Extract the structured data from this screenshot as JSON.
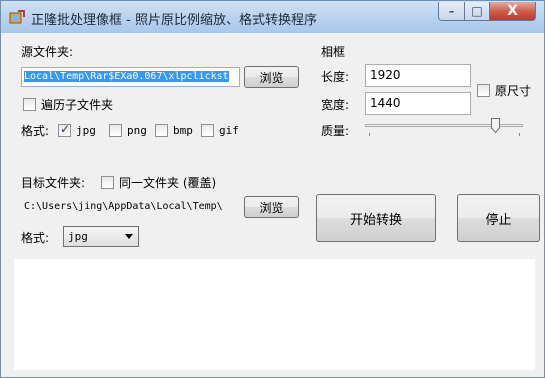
{
  "window": {
    "title": "正隆批处理像框 - 照片原比例缩放、格式转换程序",
    "minimize_label": "–",
    "maximize_label": "□",
    "close_label": "X"
  },
  "source": {
    "folder_label": "源文件夹:",
    "path_value": "Local\\Temp\\Rar$EXa0.067\\xlpclickst",
    "browse_label": "浏览",
    "subfolders_label": "遍历子文件夹",
    "subfolders_checked": false,
    "format_label": "格式:",
    "formats": [
      {
        "label": "jpg",
        "checked": true
      },
      {
        "label": "png",
        "checked": false
      },
      {
        "label": "bmp",
        "checked": false
      },
      {
        "label": "gif",
        "checked": false
      }
    ]
  },
  "frame": {
    "group_label": "相框",
    "length_label": "长度:",
    "length_value": "1920",
    "width_label": "宽度:",
    "width_value": "1440",
    "original_size_label": "原尺寸",
    "original_size_checked": false,
    "quality_label": "质量:",
    "quality_level": 0.82
  },
  "target": {
    "folder_label": "目标文件夹:",
    "same_folder_label": "同一文件夹 (覆盖)",
    "same_folder_checked": false,
    "path_value": "C:\\Users\\jing\\AppData\\Local\\Temp\\",
    "browse_label": "浏览",
    "format_label": "格式:",
    "format_selected": "jpg"
  },
  "actions": {
    "start_label": "开始转换",
    "stop_label": "停止"
  }
}
